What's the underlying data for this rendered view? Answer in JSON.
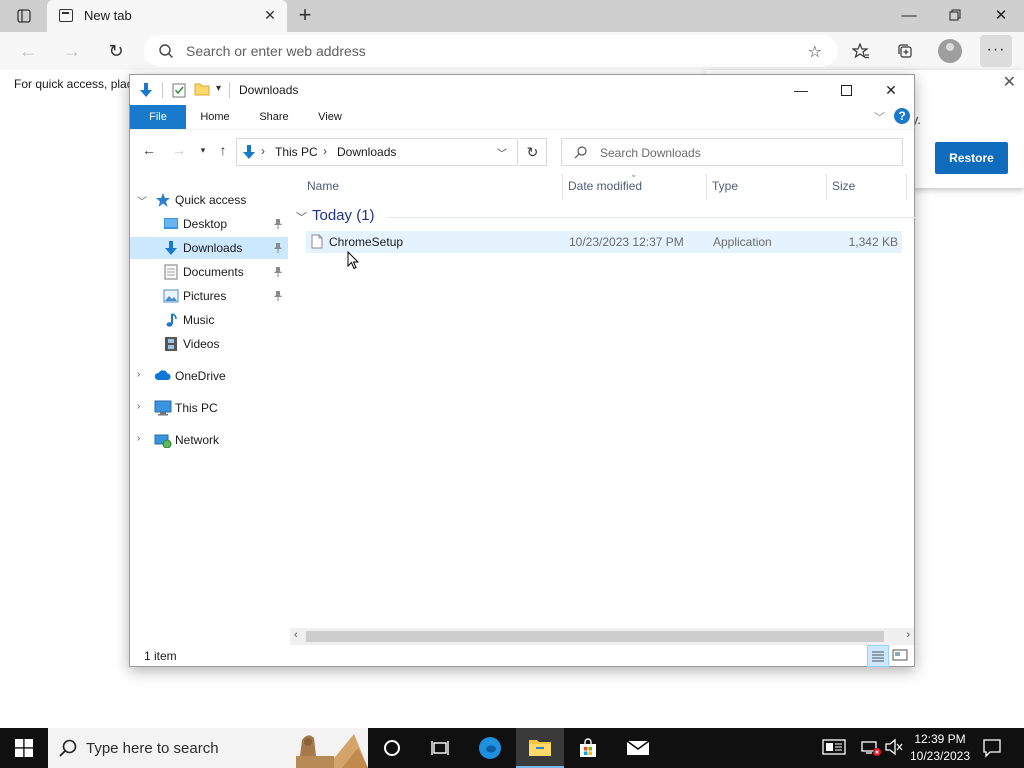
{
  "browser": {
    "tab_title": "New tab",
    "address_placeholder": "Search or enter web address",
    "favorites_hint": "For quick access, plac",
    "restore_text": "ily.",
    "restore_label": "Restore"
  },
  "explorer": {
    "title": "Downloads",
    "ribbon_tabs": [
      "File",
      "Home",
      "Share",
      "View"
    ],
    "breadcrumb": [
      "This PC",
      "Downloads"
    ],
    "search_placeholder": "Search Downloads",
    "nav": {
      "quick_access": "Quick access",
      "items": [
        "Desktop",
        "Downloads",
        "Documents",
        "Pictures",
        "Music",
        "Videos"
      ],
      "onedrive": "OneDrive",
      "this_pc": "This PC",
      "network": "Network"
    },
    "columns": [
      "Name",
      "Date modified",
      "Type",
      "Size"
    ],
    "group": "Today (1)",
    "files": [
      {
        "name": "ChromeSetup",
        "date": "10/23/2023 12:37 PM",
        "type": "Application",
        "size": "1,342 KB"
      }
    ],
    "status": "1 item"
  },
  "taskbar": {
    "search_placeholder": "Type here to search",
    "time": "12:39 PM",
    "date": "10/23/2023"
  },
  "colors": {
    "accent": "#1979ca",
    "selection": "#cce8ff",
    "row_hover": "#e5f3ff",
    "restore_button": "#0f6cbd",
    "group_title": "#1e3287",
    "taskbar": "#101010"
  }
}
